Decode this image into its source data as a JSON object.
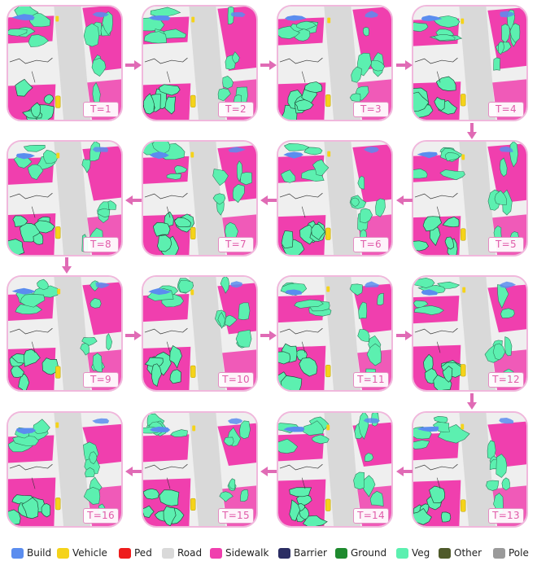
{
  "frames": [
    {
      "label": "T=1"
    },
    {
      "label": "T=2"
    },
    {
      "label": "T=3"
    },
    {
      "label": "T=4"
    },
    {
      "label": "T=5"
    },
    {
      "label": "T=6"
    },
    {
      "label": "T=7"
    },
    {
      "label": "T=8"
    },
    {
      "label": "T=9"
    },
    {
      "label": "T=10"
    },
    {
      "label": "T=11"
    },
    {
      "label": "T=12"
    },
    {
      "label": "T=13"
    },
    {
      "label": "T=14"
    },
    {
      "label": "T=15"
    },
    {
      "label": "T=16"
    }
  ],
  "flow": "serpentine",
  "colors": {
    "panel_border": "#f0b8dc",
    "arrow": "#e06bb5",
    "label_text": "#e05ba9",
    "label_border": "#e58cc2"
  },
  "legend": [
    {
      "label": "Build",
      "color": "#5b8def"
    },
    {
      "label": "Vehicle",
      "color": "#f5d31a"
    },
    {
      "label": "Ped",
      "color": "#ee1c1c"
    },
    {
      "label": "Road",
      "color": "#d9d9d9"
    },
    {
      "label": "Sidewalk",
      "color": "#f03fae"
    },
    {
      "label": "Barrier",
      "color": "#2b2d63"
    },
    {
      "label": "Ground",
      "color": "#1e8a2e"
    },
    {
      "label": "Veg",
      "color": "#5cf0b0"
    },
    {
      "label": "Other",
      "color": "#4f5a2a"
    },
    {
      "label": "Pole",
      "color": "#9a9a9a"
    }
  ]
}
